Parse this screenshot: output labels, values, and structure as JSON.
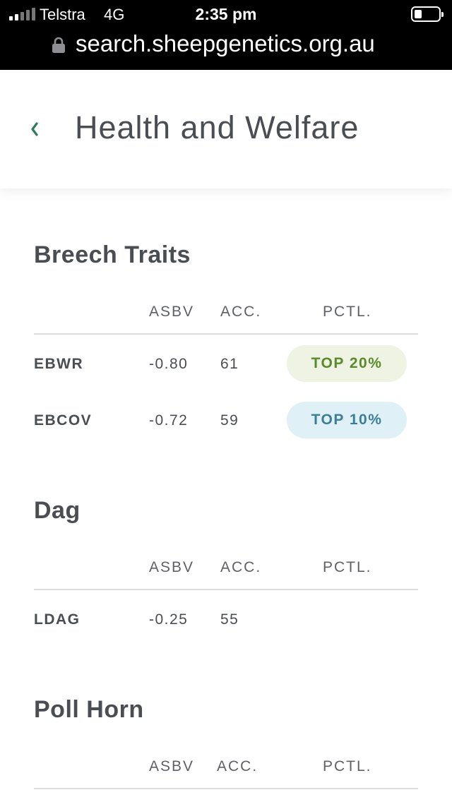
{
  "status_bar": {
    "carrier": "Telstra",
    "network": "4G",
    "time": "2:35 pm",
    "signal_bars_filled": 2,
    "signal_bars_total": 5,
    "battery_level": 0.3
  },
  "address_bar": {
    "lock_icon": "lock-icon",
    "url": "search.sheepgenetics.org.au"
  },
  "header": {
    "back_icon": "chevron-left-icon",
    "title": "Health and Welfare"
  },
  "colors": {
    "accent_green": "#2f7a5d",
    "badge_top20_bg": "#eef3e3",
    "badge_top20_text": "#5a8a2a",
    "badge_top10_bg": "#dff1f7",
    "badge_top10_text": "#3b7f94"
  },
  "sections": [
    {
      "title": "Breech Traits",
      "columns": [
        "ASBV",
        "ACC.",
        "PCTL."
      ],
      "rows": [
        {
          "trait": "EBWR",
          "asbv": "-0.80",
          "acc": "61",
          "pctl": "TOP 20%",
          "pctl_style": "top20"
        },
        {
          "trait": "EBCOV",
          "asbv": "-0.72",
          "acc": "59",
          "pctl": "TOP 10%",
          "pctl_style": "top10"
        }
      ]
    },
    {
      "title": "Dag",
      "columns": [
        "ASBV",
        "ACC.",
        "PCTL."
      ],
      "rows": [
        {
          "trait": "LDAG",
          "asbv": "-0.25",
          "acc": "55",
          "pctl": ""
        }
      ]
    },
    {
      "title": "Poll Horn",
      "columns": [
        "ASBV",
        "ACC.",
        "PCTL."
      ],
      "rows": []
    }
  ]
}
